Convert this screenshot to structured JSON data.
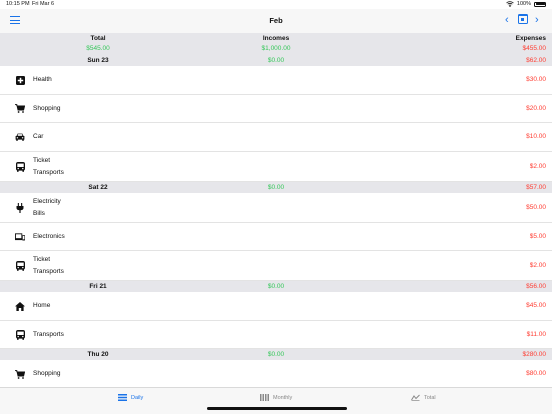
{
  "status": {
    "time": "10:15 PM",
    "date": "Fri Mar 6",
    "battery": "100%"
  },
  "nav": {
    "title": "Feb",
    "prev": "‹",
    "next": "›"
  },
  "summary": {
    "total_label": "Total",
    "total_value": "$545.00",
    "incomes_label": "Incomes",
    "incomes_value": "$1,000.00",
    "expenses_label": "Expenses",
    "expenses_value": "$455.00"
  },
  "days": [
    {
      "date": "Sun 23",
      "income": "$0.00",
      "expense": "$62.00",
      "items": [
        {
          "icon": "health-icon",
          "lines": [
            "Health"
          ],
          "amount": "$30.00"
        },
        {
          "icon": "cart-icon",
          "lines": [
            "Shopping"
          ],
          "amount": "$20.00"
        },
        {
          "icon": "car-icon",
          "lines": [
            "Car"
          ],
          "amount": "$10.00"
        },
        {
          "icon": "bus-icon",
          "lines": [
            "Ticket",
            "Transports"
          ],
          "amount": "$2.00"
        }
      ]
    },
    {
      "date": "Sat 22",
      "income": "$0.00",
      "expense": "$57.00",
      "items": [
        {
          "icon": "plug-icon",
          "lines": [
            "Electricity",
            "Bills"
          ],
          "amount": "$50.00"
        },
        {
          "icon": "devices-icon",
          "lines": [
            "Electronics"
          ],
          "amount": "$5.00"
        },
        {
          "icon": "bus-icon",
          "lines": [
            "Ticket",
            "Transports"
          ],
          "amount": "$2.00"
        }
      ]
    },
    {
      "date": "Fri 21",
      "income": "$0.00",
      "expense": "$56.00",
      "items": [
        {
          "icon": "home-icon",
          "lines": [
            "Home"
          ],
          "amount": "$45.00"
        },
        {
          "icon": "bus-icon",
          "lines": [
            "Transports"
          ],
          "amount": "$11.00"
        }
      ]
    },
    {
      "date": "Thu 20",
      "income": "$0.00",
      "expense": "$280.00",
      "items": [
        {
          "icon": "cart-icon",
          "lines": [
            "Shopping"
          ],
          "amount": "$80.00"
        }
      ]
    }
  ],
  "tabs": [
    {
      "label": "Daily",
      "icon": "daily-list-icon",
      "active": true
    },
    {
      "label": "Monthly",
      "icon": "monthly-bars-icon",
      "active": false
    },
    {
      "label": "Total",
      "icon": "total-chart-icon",
      "active": false
    }
  ],
  "colors": {
    "accent": "#1a73e8",
    "income": "#34c759",
    "expense": "#ff3b30"
  }
}
